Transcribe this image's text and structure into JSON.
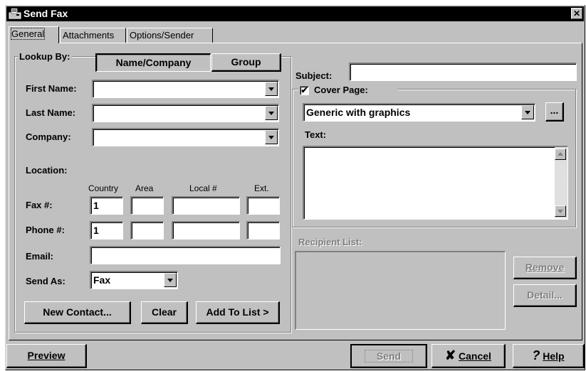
{
  "window": {
    "title": "Send Fax",
    "close_glyph": "✕"
  },
  "tabs": [
    {
      "label": "General",
      "active": true
    },
    {
      "label": "Attachments",
      "active": false
    },
    {
      "label": "Options/Sender",
      "active": false
    }
  ],
  "lookup": {
    "legend": "Lookup By:",
    "name_company_button": "Name/Company",
    "group_button": "Group"
  },
  "contact": {
    "first_name_label": "First Name:",
    "first_name_value": "",
    "last_name_label": "Last Name:",
    "last_name_value": "",
    "company_label": "Company:",
    "company_value": ""
  },
  "location": {
    "label": "Location:",
    "col_country": "Country",
    "col_area": "Area",
    "col_local": "Local #",
    "col_ext": "Ext.",
    "fax_label": "Fax #:",
    "fax_country": "1",
    "fax_area": "",
    "fax_local": "",
    "fax_ext": "",
    "phone_label": "Phone #:",
    "phone_country": "1",
    "phone_area": "",
    "phone_local": "",
    "phone_ext": ""
  },
  "email": {
    "label": "Email:",
    "value": ""
  },
  "send_as": {
    "label": "Send As:",
    "value": "Fax"
  },
  "contact_buttons": {
    "new_contact": "New Contact...",
    "clear": "Clear",
    "add_to_list": "Add To List >"
  },
  "subject": {
    "label": "Subject:",
    "value": ""
  },
  "cover_page": {
    "label": "Cover Page:",
    "checked": "✔",
    "template": "Generic with graphics",
    "browse": "...",
    "text_label": "Text:",
    "text_value": ""
  },
  "recipients": {
    "label": "Recipient List:",
    "remove": "Remove",
    "detail": "Detail..."
  },
  "footer": {
    "preview": "Preview",
    "send": "Send",
    "cancel": "Cancel",
    "cancel_icon": "✘",
    "help": "Help",
    "help_icon": "?"
  }
}
